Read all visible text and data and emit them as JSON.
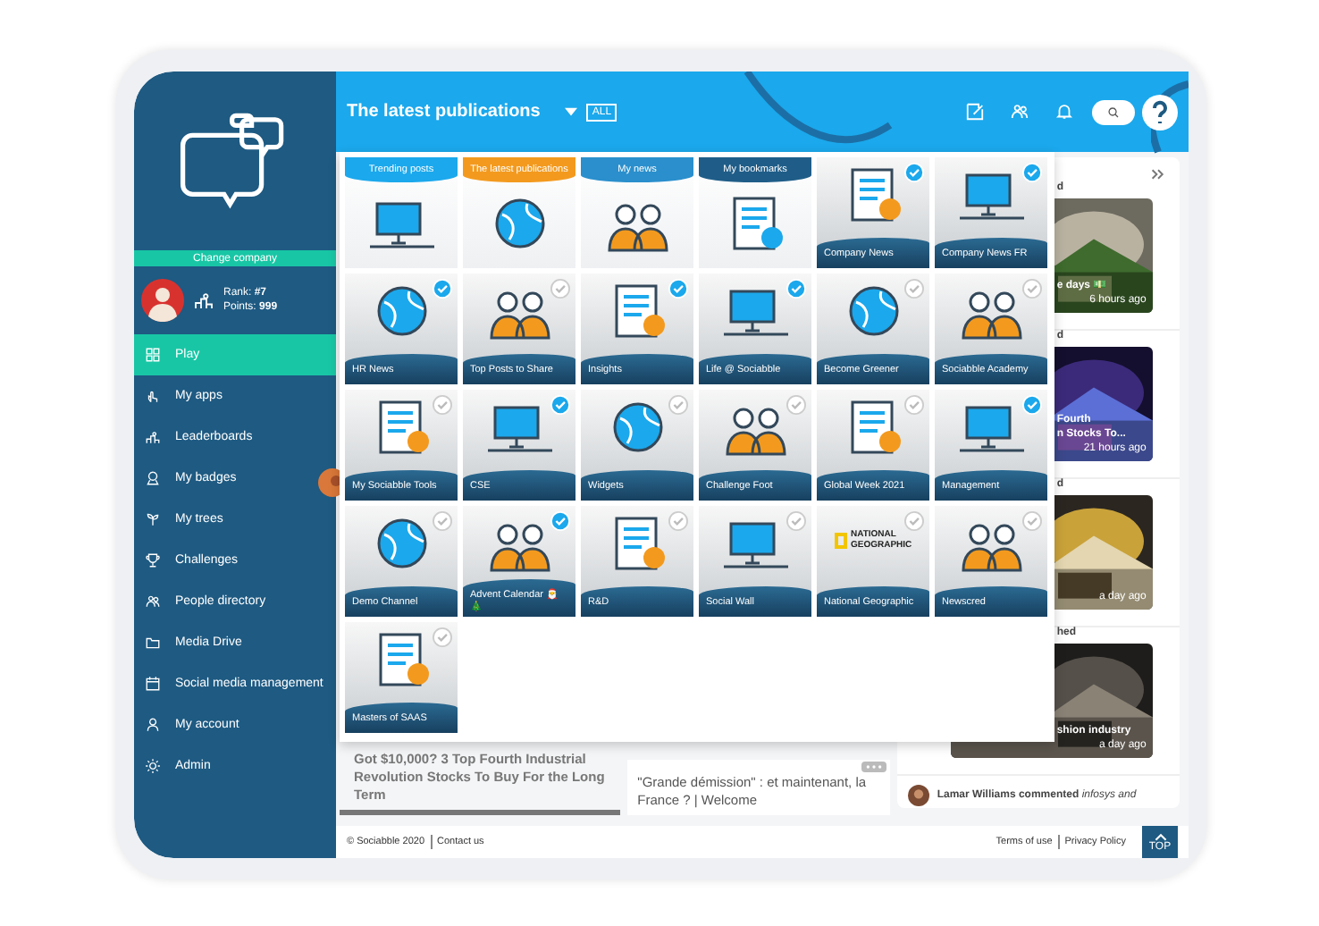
{
  "sidebar": {
    "change_company": "Change company",
    "rank": "Rank: **#7**",
    "points": "Points: **999**",
    "menu": [
      {
        "label": "Play",
        "selected": true
      },
      {
        "label": "My apps",
        "selected": false
      },
      {
        "label": "Leaderboards",
        "selected": false
      },
      {
        "label": "My badges",
        "selected": false
      },
      {
        "label": "My trees",
        "selected": false
      },
      {
        "label": "Challenges",
        "selected": false
      },
      {
        "label": "People directory",
        "selected": false
      },
      {
        "label": "Media Drive",
        "selected": false
      },
      {
        "label": "Social media management",
        "selected": false
      },
      {
        "label": "My account",
        "selected": false
      },
      {
        "label": "Admin",
        "selected": false
      }
    ]
  },
  "header": {
    "title": "The latest publications",
    "filter": "ALL"
  },
  "dropdown": {
    "tabs": [
      {
        "label": "Trending posts",
        "color": "#1ba8ec"
      },
      {
        "label": "The latest publications",
        "color": "#f39a1e"
      },
      {
        "label": "My news",
        "color": "#2a8fcc"
      },
      {
        "label": "My bookmarks",
        "color": "#1f5d88"
      }
    ],
    "channels": [
      {
        "label": "Company News",
        "subscribed": true,
        "kind": "illustration"
      },
      {
        "label": "Company News FR",
        "subscribed": true,
        "kind": "illustration"
      },
      {
        "label": "HR News",
        "subscribed": true,
        "kind": "illustration"
      },
      {
        "label": "Top Posts to Share",
        "subscribed": false,
        "kind": "illustration"
      },
      {
        "label": "Insights",
        "subscribed": true,
        "kind": "illustration"
      },
      {
        "label": "Life @ Sociabble",
        "subscribed": true,
        "kind": "illustration"
      },
      {
        "label": "Become Greener",
        "subscribed": false,
        "kind": "illustration"
      },
      {
        "label": "Sociabble Academy",
        "subscribed": false,
        "kind": "illustration"
      },
      {
        "label": "My Sociabble Tools",
        "subscribed": false,
        "kind": "illustration"
      },
      {
        "label": "CSE",
        "subscribed": true,
        "kind": "illustration"
      },
      {
        "label": "Widgets",
        "subscribed": false,
        "kind": "illustration"
      },
      {
        "label": "Challenge Foot",
        "subscribed": false,
        "kind": "illustration"
      },
      {
        "label": "Global Week 2021",
        "subscribed": false,
        "kind": "illustration"
      },
      {
        "label": "Management",
        "subscribed": true,
        "kind": "illustration"
      },
      {
        "label": "Demo Channel",
        "subscribed": false,
        "kind": "illustration"
      },
      {
        "label": "Advent Calendar 🎅 🎄",
        "subscribed": true,
        "kind": "illustration"
      },
      {
        "label": "R&D",
        "subscribed": false,
        "kind": "illustration"
      },
      {
        "label": "Social Wall",
        "subscribed": false,
        "kind": "illustration"
      },
      {
        "label": "National Geographic",
        "subscribed": false,
        "kind": "logo",
        "logo_text": "NATIONAL GEOGRAPHIC"
      },
      {
        "label": "Newscred",
        "subscribed": false,
        "kind": "illustration"
      },
      {
        "label": "Masters of SAAS",
        "subscribed": false,
        "kind": "illustration"
      }
    ]
  },
  "articles": [
    {
      "title": "Got $10,000? 3 Top Fourth Industrial Revolution Stocks To Buy For the Long Term"
    },
    {
      "title": "\"Grande démission\" : et maintenant, la France ? | Welcome"
    }
  ],
  "feed": {
    "sections": [
      {
        "heading": "d",
        "caption": [
          "e days 💵"
        ],
        "time": "6 hours ago"
      },
      {
        "heading": "d",
        "caption": [
          "Fourth",
          "n Stocks To..."
        ],
        "time": "21 hours ago"
      },
      {
        "heading": "d",
        "time": "a day ago"
      },
      {
        "heading": "hed",
        "caption": [
          "shion industry"
        ],
        "time": "a day ago"
      }
    ],
    "comment": "**Lamar Williams commented** *infosys and*"
  },
  "footer": {
    "copyright": "© Sociabble 2020",
    "links": [
      "Contact us",
      "Terms of use",
      "Privacy Policy"
    ],
    "top": "TOP"
  }
}
